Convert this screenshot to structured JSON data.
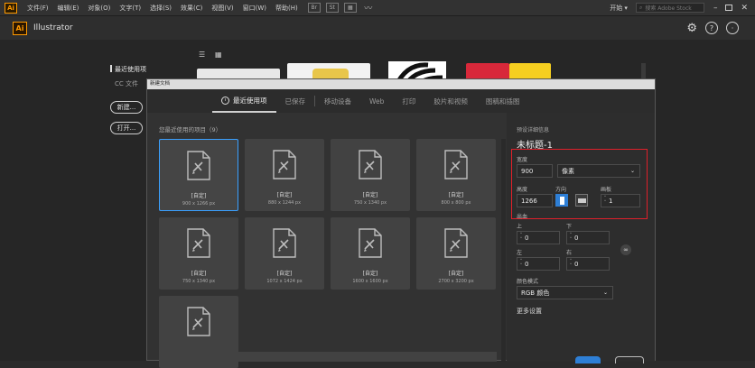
{
  "menubar": {
    "logo": "Ai",
    "items": [
      "文件(F)",
      "编辑(E)",
      "对象(O)",
      "文字(T)",
      "选择(S)",
      "效果(C)",
      "视图(V)",
      "窗口(W)",
      "帮助(H)"
    ],
    "badges": [
      "Br",
      "St"
    ],
    "workspace": "开始",
    "search_placeholder": "搜索 Adobe Stock"
  },
  "titlebar": {
    "logo": "Ai",
    "title": "Illustrator"
  },
  "start": {
    "recent_label": "最近使用项",
    "cc_label": "CC 文件",
    "new_button": "新建...",
    "open_button": "打开..."
  },
  "dialog": {
    "title": "新建文档",
    "tabs": [
      "最近使用项",
      "已保存",
      "移动设备",
      "Web",
      "打印",
      "胶片和视频",
      "图稿和插图"
    ],
    "section_label": "您最近使用的项目（9）",
    "presets": [
      {
        "name": "[自定]",
        "size": "900 x 1266 px",
        "selected": true
      },
      {
        "name": "[自定]",
        "size": "880 x 1244 px",
        "selected": false
      },
      {
        "name": "[自定]",
        "size": "750 x 1340 px",
        "selected": false
      },
      {
        "name": "[自定]",
        "size": "800 x 800 px",
        "selected": false
      },
      {
        "name": "[自定]",
        "size": "750 x 1340 px",
        "selected": false
      },
      {
        "name": "[自定]",
        "size": "1072 x 1424 px",
        "selected": false
      },
      {
        "name": "[自定]",
        "size": "1600 x 1600 px",
        "selected": false
      },
      {
        "name": "[自定]",
        "size": "2700 x 3200 px",
        "selected": false
      },
      {
        "name": "",
        "size": "",
        "selected": false
      }
    ]
  },
  "details": {
    "header": "预设详细信息",
    "doc_name": "未标题-1",
    "width_label": "宽度",
    "width_value": "900",
    "unit_value": "像素",
    "height_label": "高度",
    "height_value": "1266",
    "orientation_label": "方向",
    "artboards_label": "画板",
    "artboards_value": "1",
    "bleed_label": "出血",
    "top_label": "上",
    "top_value": "0",
    "bottom_label": "下",
    "bottom_value": "0",
    "left_label": "左",
    "left_value": "0",
    "right_label": "右",
    "right_value": "0",
    "color_mode_label": "颜色模式",
    "color_mode_value": "RGB 颜色",
    "more_settings": "更多设置"
  },
  "colors": {
    "accent": "#3aa0ff",
    "highlight_box": "#e0202a",
    "ai_orange": "#ff9a00"
  }
}
